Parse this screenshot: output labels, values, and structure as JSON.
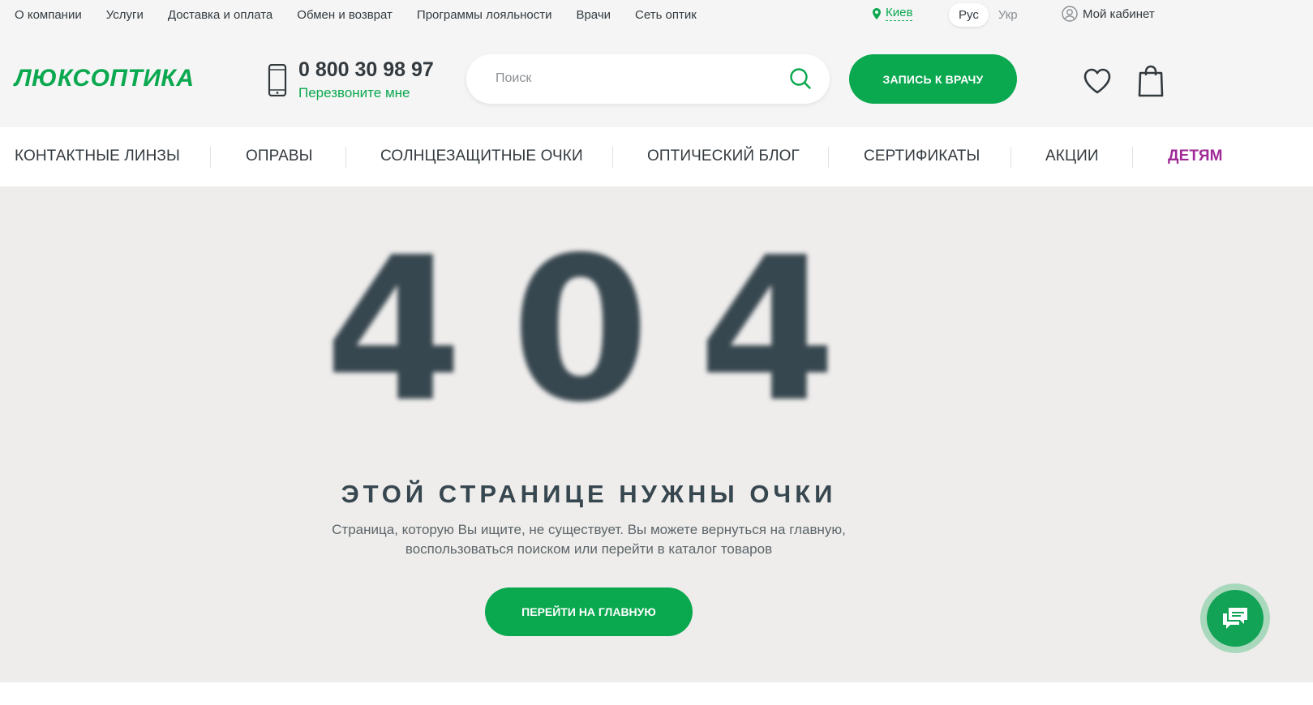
{
  "top_links": [
    "О компании",
    "Услуги",
    "Доставка и оплата",
    "Обмен и возврат",
    "Программы лояльности",
    "Врачи",
    "Сеть оптик"
  ],
  "city": "Киев",
  "languages": {
    "active": "Рус",
    "other": "Укр"
  },
  "cabinet_label": "Мой кабинет",
  "logo_text": "ЛЮКСОПТИКА",
  "phone_number": "0 800 30 98 97",
  "callback_label": "Перезвоните мне",
  "search": {
    "placeholder": "Поиск"
  },
  "book_button": "ЗАПИСЬ К ВРАЧУ",
  "main_nav": [
    "КОНТАКТНЫЕ ЛИНЗЫ",
    "ОПРАВЫ",
    "СОЛНЦЕЗАЩИТНЫЕ ОЧКИ",
    "ОПТИЧЕСКИЙ БЛОГ",
    "СЕРТИФИКАТЫ",
    "АКЦИИ",
    "ДЕТЯМ"
  ],
  "error": {
    "code": "404",
    "headline": "ЭТОЙ СТРАНИЦЕ НУЖНЫ ОЧКИ",
    "description_line1": "Страница, которую Вы ищите, не существует. Вы можете вернуться на главную,",
    "description_line2": "воспользоваться поиском или перейти в каталог товаров",
    "home_button": "ПЕРЕЙТИ НА ГЛАВНУЮ"
  },
  "colors": {
    "brand_green": "#0aa84f",
    "kids_purple": "#a02a97",
    "hero_bg": "#efedec",
    "text_dark": "#37474f"
  },
  "icons": [
    "phone-icon",
    "search-icon",
    "heart-icon",
    "bag-icon",
    "location-pin-icon",
    "user-icon",
    "chat-icon"
  ]
}
